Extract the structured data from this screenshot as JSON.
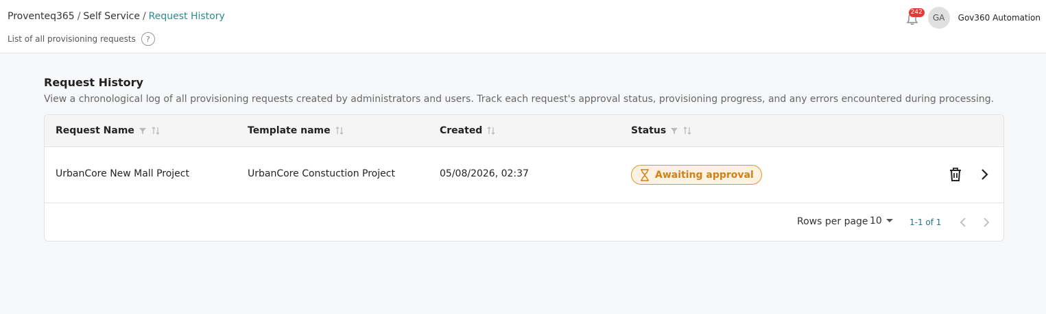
{
  "breadcrumb": {
    "items": [
      "Proventeq365",
      "Self Service",
      "Request History"
    ]
  },
  "subtitle": {
    "text": "List of all provisioning requests",
    "help_glyph": "?"
  },
  "header": {
    "notification_count": "242",
    "avatar_initials": "GA",
    "username": "Gov360 Automation"
  },
  "section": {
    "title": "Request History",
    "description": "View a chronological log of all provisioning requests created by administrators and users. Track each request's approval status, provisioning progress, and any errors encountered during processing."
  },
  "table": {
    "columns": [
      {
        "label": "Request Name",
        "filter": true,
        "sort": true
      },
      {
        "label": "Template name",
        "filter": false,
        "sort": true
      },
      {
        "label": "Created",
        "filter": false,
        "sort": true
      },
      {
        "label": "Status",
        "filter": true,
        "sort": true
      }
    ],
    "rows": [
      {
        "request_name": "UrbanCore New Mall Project",
        "template_name": "UrbanCore Constuction Project",
        "created": "05/08/2026, 02:37",
        "status": "Awaiting approval"
      }
    ]
  },
  "pagination": {
    "rows_per_page_label": "Rows per page",
    "rows_per_page_value": "10",
    "range_text": "1-1 of 1"
  },
  "colors": {
    "accent": "#2a8c8c",
    "status_pending": "#d2801a",
    "badge_red": "#e53935"
  }
}
